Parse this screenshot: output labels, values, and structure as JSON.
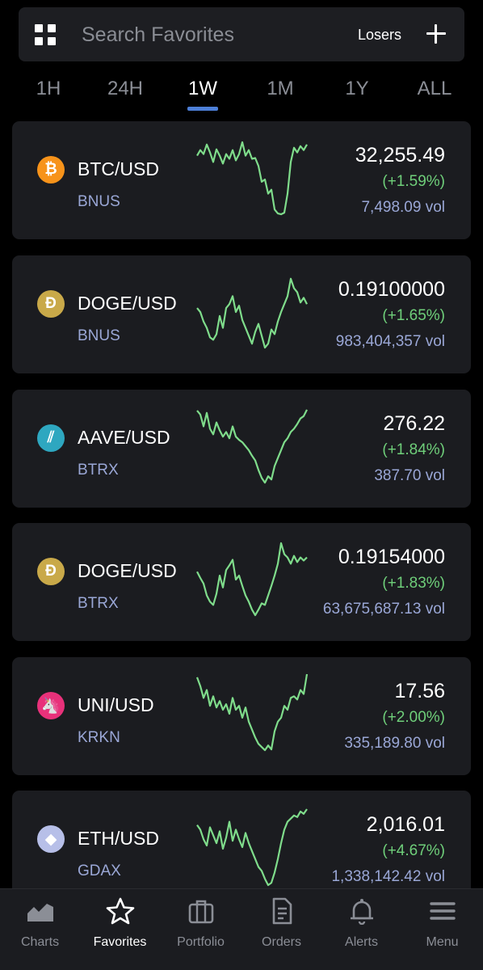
{
  "search": {
    "placeholder": "Search Favorites",
    "sort_label": "Losers"
  },
  "tabs": [
    {
      "label": "1H",
      "active": false
    },
    {
      "label": "24H",
      "active": false
    },
    {
      "label": "1W",
      "active": true
    },
    {
      "label": "1M",
      "active": false
    },
    {
      "label": "1Y",
      "active": false
    },
    {
      "label": "ALL",
      "active": false
    }
  ],
  "spark_color": "#7fdc8b",
  "favorites": [
    {
      "pair": "BTC/USD",
      "exchange": "BNUS",
      "price": "32,255.49",
      "change": "(+1.59%)",
      "volume": "7,498.09 vol",
      "icon": "bitcoin-icon",
      "icon_color": "#f7931a",
      "icon_glyph": "₿",
      "spark": [
        0.78,
        0.85,
        0.8,
        0.92,
        0.82,
        0.7,
        0.86,
        0.78,
        0.68,
        0.8,
        0.74,
        0.85,
        0.72,
        0.8,
        0.95,
        0.78,
        0.85,
        0.74,
        0.75,
        0.65,
        0.45,
        0.48,
        0.3,
        0.35,
        0.1,
        0.05,
        0.04,
        0.06,
        0.3,
        0.7,
        0.88,
        0.82,
        0.9,
        0.85,
        0.92
      ]
    },
    {
      "pair": "DOGE/USD",
      "exchange": "BNUS",
      "price": "0.19100000",
      "change": "(+1.65%)",
      "volume": "983,404,357 vol",
      "icon": "dogecoin-icon",
      "icon_color": "#c9a949",
      "icon_glyph": "Ð",
      "spark": [
        0.55,
        0.5,
        0.38,
        0.3,
        0.18,
        0.15,
        0.22,
        0.45,
        0.3,
        0.55,
        0.6,
        0.7,
        0.5,
        0.58,
        0.4,
        0.3,
        0.2,
        0.1,
        0.25,
        0.35,
        0.2,
        0.05,
        0.1,
        0.28,
        0.22,
        0.38,
        0.5,
        0.6,
        0.7,
        0.92,
        0.8,
        0.75,
        0.62,
        0.68,
        0.6
      ]
    },
    {
      "pair": "AAVE/USD",
      "exchange": "BTRX",
      "price": "276.22",
      "change": "(+1.84%)",
      "volume": "387.70 vol",
      "icon": "aave-icon",
      "icon_color": "#2ea7c0",
      "icon_glyph": "⫽",
      "spark": [
        0.95,
        0.9,
        0.75,
        0.92,
        0.72,
        0.65,
        0.8,
        0.7,
        0.62,
        0.68,
        0.6,
        0.75,
        0.62,
        0.58,
        0.55,
        0.5,
        0.45,
        0.38,
        0.32,
        0.2,
        0.1,
        0.04,
        0.12,
        0.08,
        0.25,
        0.35,
        0.45,
        0.55,
        0.6,
        0.68,
        0.72,
        0.78,
        0.85,
        0.88,
        0.96
      ]
    },
    {
      "pair": "DOGE/USD",
      "exchange": "BTRX",
      "price": "0.19154000",
      "change": "(+1.83%)",
      "volume": "63,675,687.13 vol",
      "icon": "dogecoin-icon",
      "icon_color": "#c9a949",
      "icon_glyph": "Ð",
      "spark": [
        0.6,
        0.52,
        0.45,
        0.3,
        0.22,
        0.18,
        0.32,
        0.55,
        0.4,
        0.62,
        0.68,
        0.75,
        0.5,
        0.55,
        0.42,
        0.3,
        0.22,
        0.12,
        0.05,
        0.12,
        0.2,
        0.18,
        0.3,
        0.42,
        0.55,
        0.7,
        0.96,
        0.82,
        0.78,
        0.7,
        0.8,
        0.72,
        0.78,
        0.74,
        0.78
      ]
    },
    {
      "pair": "UNI/USD",
      "exchange": "KRKN",
      "price": "17.56",
      "change": "(+2.00%)",
      "volume": "335,189.80 vol",
      "icon": "uniswap-icon",
      "icon_color": "#e8317a",
      "icon_glyph": "🦄",
      "spark": [
        0.96,
        0.85,
        0.7,
        0.8,
        0.6,
        0.72,
        0.58,
        0.66,
        0.55,
        0.62,
        0.5,
        0.7,
        0.55,
        0.6,
        0.45,
        0.58,
        0.4,
        0.3,
        0.2,
        0.12,
        0.08,
        0.04,
        0.1,
        0.05,
        0.28,
        0.4,
        0.45,
        0.6,
        0.55,
        0.7,
        0.72,
        0.68,
        0.8,
        0.75,
        1.0
      ]
    },
    {
      "pair": "ETH/USD",
      "exchange": "GDAX",
      "price": "2,016.01",
      "change": "(+4.67%)",
      "volume": "1,338,142.42 vol",
      "icon": "ethereum-icon",
      "icon_color": "#b7bfe8",
      "icon_glyph": "◆",
      "spark": [
        0.78,
        0.72,
        0.6,
        0.52,
        0.75,
        0.65,
        0.55,
        0.7,
        0.48,
        0.62,
        0.82,
        0.58,
        0.72,
        0.6,
        0.5,
        0.68,
        0.55,
        0.45,
        0.35,
        0.25,
        0.2,
        0.1,
        0.02,
        0.05,
        0.18,
        0.35,
        0.55,
        0.72,
        0.82,
        0.86,
        0.9,
        0.88,
        0.95,
        0.92,
        0.98
      ]
    }
  ],
  "nav": [
    {
      "label": "Charts",
      "icon": "charts-icon",
      "active": false
    },
    {
      "label": "Favorites",
      "icon": "star-icon",
      "active": true
    },
    {
      "label": "Portfolio",
      "icon": "briefcase-icon",
      "active": false
    },
    {
      "label": "Orders",
      "icon": "document-icon",
      "active": false
    },
    {
      "label": "Alerts",
      "icon": "bell-icon",
      "active": false
    },
    {
      "label": "Menu",
      "icon": "hamburger-icon",
      "active": false
    }
  ]
}
